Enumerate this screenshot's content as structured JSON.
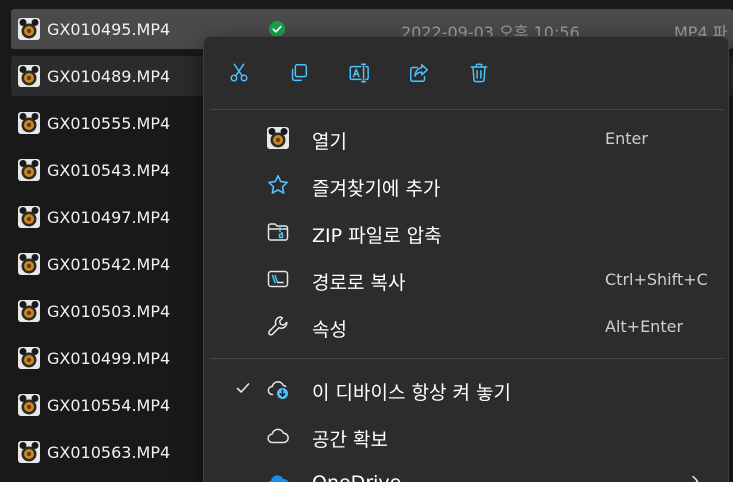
{
  "files": [
    {
      "name": "GX010495.MP4",
      "date": "2022-09-03 오후 10:56",
      "type": "MP4 파",
      "selected": true,
      "sync": true
    },
    {
      "name": "GX010489.MP4",
      "hover": true
    },
    {
      "name": "GX010555.MP4"
    },
    {
      "name": "GX010543.MP4"
    },
    {
      "name": "GX010497.MP4"
    },
    {
      "name": "GX010542.MP4"
    },
    {
      "name": "GX010503.MP4"
    },
    {
      "name": "GX010499.MP4"
    },
    {
      "name": "GX010554.MP4"
    },
    {
      "name": "GX010563.MP4"
    }
  ],
  "context_menu": {
    "toolbar": [
      {
        "name": "cut-button",
        "icon": "scissors-icon"
      },
      {
        "name": "copy-button",
        "icon": "copy-icon"
      },
      {
        "name": "rename-button",
        "icon": "rename-icon"
      },
      {
        "name": "share-button",
        "icon": "share-icon"
      },
      {
        "name": "delete-button",
        "icon": "trash-icon"
      }
    ],
    "items": [
      {
        "name": "menu-item-open",
        "icon": "media-file-icon",
        "label": "열기",
        "shortcut": "Enter"
      },
      {
        "name": "menu-item-add-favorites",
        "icon": "star-icon",
        "label": "즐겨찾기에 추가",
        "shortcut": ""
      },
      {
        "name": "menu-item-compress-zip",
        "icon": "zip-folder-icon",
        "label": "ZIP 파일로 압축",
        "shortcut": ""
      },
      {
        "name": "menu-item-copy-path",
        "icon": "copy-path-icon",
        "label": "경로로 복사",
        "shortcut": "Ctrl+Shift+C"
      },
      {
        "name": "menu-item-properties",
        "icon": "wrench-icon",
        "label": "속성",
        "shortcut": "Alt+Enter"
      },
      {
        "name": "menu-item-always-keep",
        "icon": "cloud-download-icon",
        "label": "이 디바이스 항상 켜 놓기",
        "shortcut": "",
        "checked": true
      },
      {
        "name": "menu-item-free-space",
        "icon": "cloud-icon",
        "label": "공간 확보",
        "shortcut": ""
      },
      {
        "name": "menu-item-onedrive",
        "icon": "onedrive-icon",
        "label": "OneDrive",
        "shortcut": "",
        "submenu": true
      }
    ]
  },
  "colors": {
    "background": "#191919",
    "menu_background": "#2c2c2c",
    "selected_row": "#4a4a4a",
    "accent_blue": "#4cc2ff",
    "sync_green": "#16a34a",
    "secondary_text": "#9d9d9d"
  }
}
